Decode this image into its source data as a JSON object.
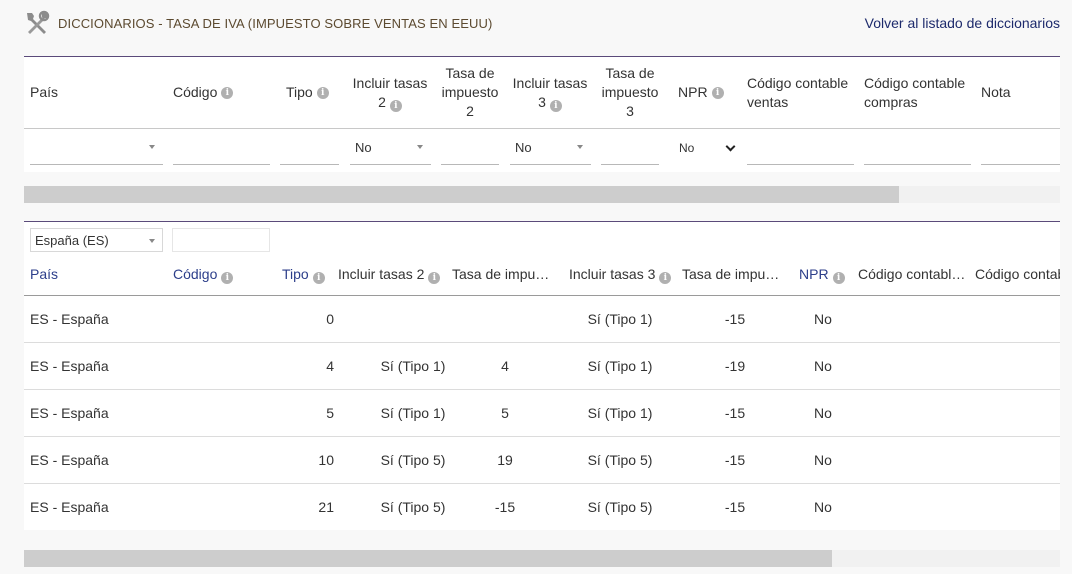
{
  "header": {
    "icon": "tools-icon",
    "title": "DICCIONARIOS - TASA DE IVA (IMPUESTO SOBRE VENTAS EN EEUU)",
    "back_link": "Volver al listado de diccionarios"
  },
  "form_table": {
    "columns": {
      "country": "País",
      "code": "Código",
      "type": "Tipo",
      "incl2_line1": "Incluir tasas",
      "incl2_line2": "2",
      "rate2_line1": "Tasa de",
      "rate2_line2": "impuesto",
      "rate2_line3": "2",
      "incl3_line1": "Incluir tasas",
      "incl3_line2": "3",
      "rate3_line1": "Tasa de",
      "rate3_line2": "impuesto",
      "rate3_line3": "3",
      "npr": "NPR",
      "acct_sales_line1": "Código contable",
      "acct_sales_line2": "ventas",
      "acct_purch_line1": "Código contable",
      "acct_purch_line2": "compras",
      "note": "Nota"
    },
    "inputs": {
      "country": "",
      "code": "",
      "type": "",
      "incl2": "No",
      "rate2": "",
      "incl3": "No",
      "rate3": "",
      "npr": "No",
      "acct_sales": "",
      "acct_purch": "",
      "note": ""
    }
  },
  "grid": {
    "country_filter": "España (ES)",
    "code_search": "",
    "columns": {
      "country": "País",
      "code": "Código",
      "type": "Tipo",
      "incl2": "Incluir tasas 2",
      "rate2": "Tasa de impue…",
      "incl3": "Incluir tasas 3",
      "rate3": "Tasa de impue…",
      "npr": "NPR",
      "acct_sales": "Código contabl…",
      "acct_purch": "Código contab"
    },
    "rows": [
      {
        "country": "ES - España",
        "type": "0",
        "incl2": "",
        "rate2": "",
        "incl3": "Sí (Tipo 1)",
        "rate3": "-15",
        "npr": "No"
      },
      {
        "country": "ES - España",
        "type": "4",
        "incl2": "Sí (Tipo 1)",
        "rate2": "4",
        "incl3": "Sí (Tipo 1)",
        "rate3": "-19",
        "npr": "No"
      },
      {
        "country": "ES - España",
        "type": "5",
        "incl2": "Sí (Tipo 1)",
        "rate2": "5",
        "incl3": "Sí (Tipo 1)",
        "rate3": "-15",
        "npr": "No"
      },
      {
        "country": "ES - España",
        "type": "10",
        "incl2": "Sí (Tipo 5)",
        "rate2": "19",
        "incl3": "Sí (Tipo 5)",
        "rate3": "-15",
        "npr": "No"
      },
      {
        "country": "ES - España",
        "type": "21",
        "incl2": "Sí (Tipo 5)",
        "rate2": "-15",
        "incl3": "Sí (Tipo 5)",
        "rate3": "-15",
        "npr": "No"
      }
    ]
  },
  "colors": {
    "accent_border": "#5a4a7a",
    "sortable_header": "#2c3e8a",
    "link": "#1d2a6c",
    "title": "#5c4a30"
  },
  "scrollbars": {
    "top_thumb_fraction": 0.845,
    "bottom_thumb_fraction": 0.78
  }
}
